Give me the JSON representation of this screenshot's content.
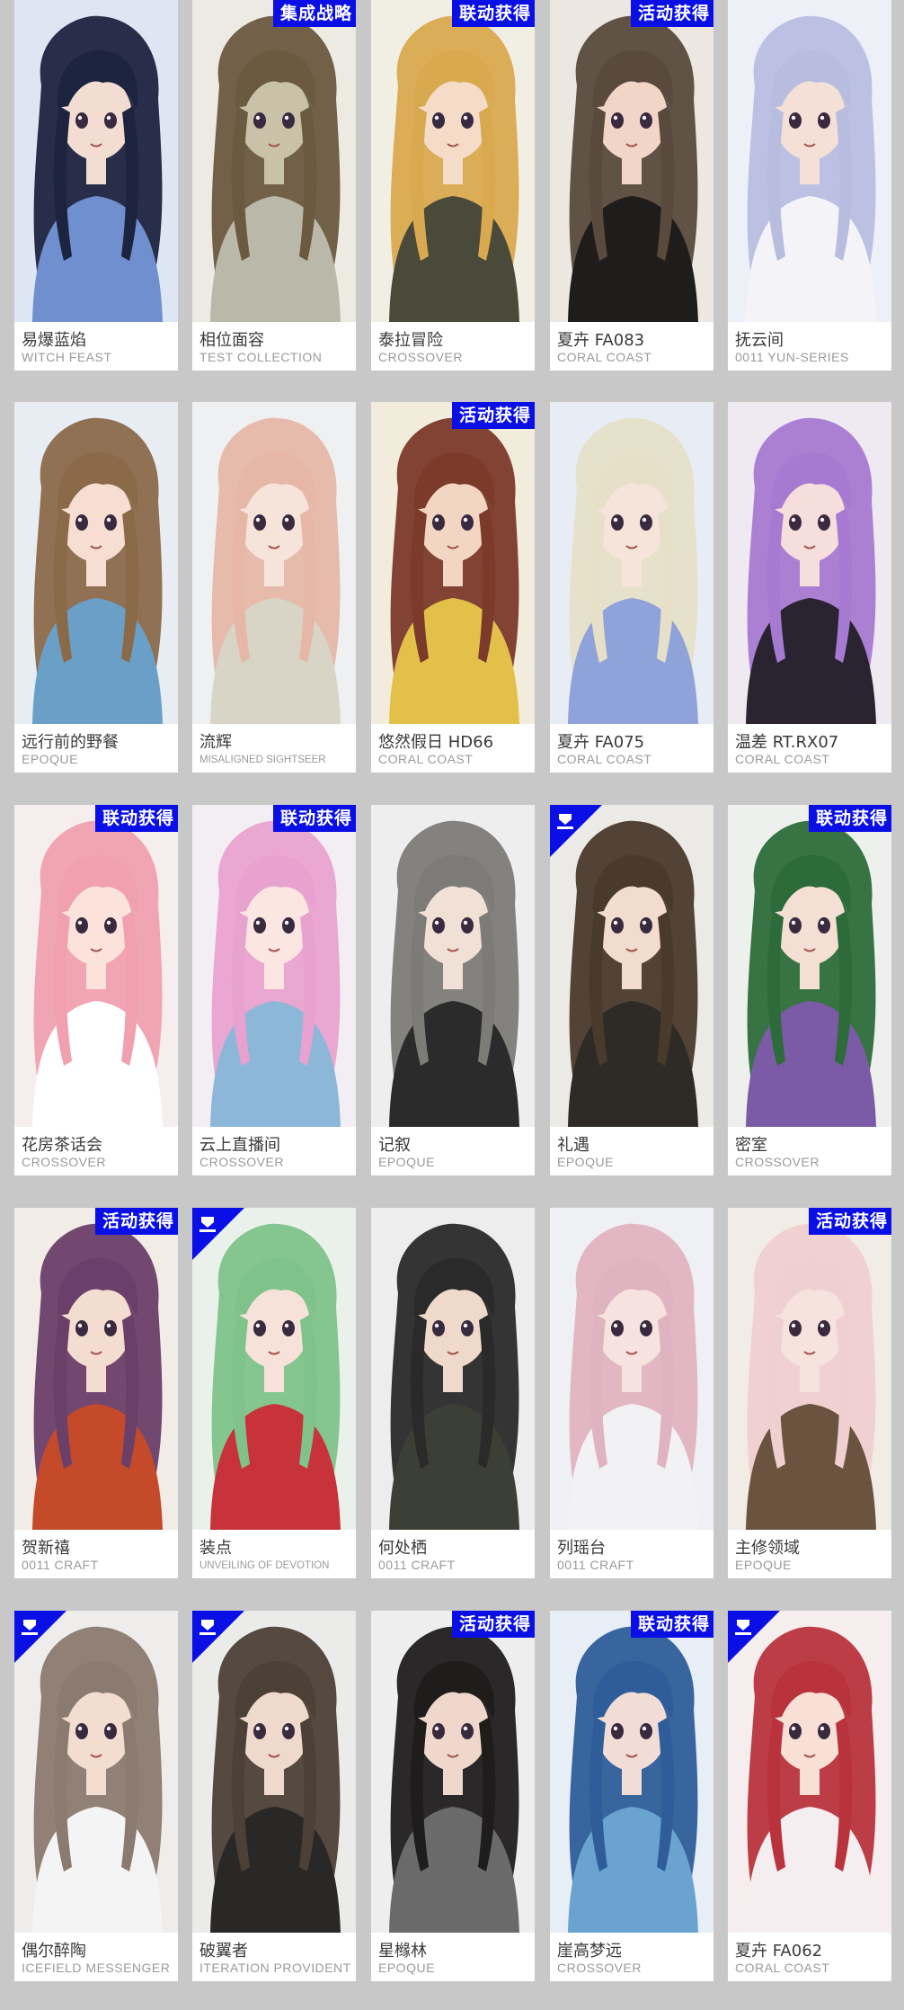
{
  "badge_color": "#0a0fe6",
  "rows": [
    [
      {
        "name": "易爆蓝焰",
        "series": "WITCH FEAST",
        "badge": "",
        "corner": false,
        "hair": "#1d2440",
        "bg": "#dfe6f3",
        "outfit": "#6f8fcf",
        "skin": "#f3ddd3"
      },
      {
        "name": "相位面容",
        "series": "TEST COLLECTION",
        "badge": "集成战略",
        "corner": false,
        "hair": "#6b5a3f",
        "bg": "#eceae3",
        "outfit": "#b9b8a9",
        "skin": "#c9c2a8"
      },
      {
        "name": "泰拉冒险",
        "series": "CROSSOVER",
        "badge": "联动获得",
        "corner": false,
        "hair": "#d9a94f",
        "bg": "#f1eee4",
        "outfit": "#4a4a3a",
        "skin": "#f4dcc8"
      },
      {
        "name": "夏卉 FA083",
        "series": "CORAL COAST",
        "badge": "活动获得",
        "corner": false,
        "hair": "#5a4a3d",
        "bg": "#ece8e1",
        "outfit": "#1f1c1c",
        "skin": "#f1d5c7"
      },
      {
        "name": "抚云间",
        "series": "0011 YUN-SERIES",
        "badge": "",
        "corner": false,
        "hair": "#b8bde0",
        "bg": "#eef0f7",
        "outfit": "#f4f4f8",
        "skin": "#f5e0d7"
      }
    ],
    [
      {
        "name": "远行前的野餐",
        "series": "EPOQUE",
        "badge": "",
        "corner": false,
        "hair": "#8b6a4a",
        "bg": "#e7edf2",
        "outfit": "#6aa0c8",
        "skin": "#f6dfd2"
      },
      {
        "name": "流辉",
        "series": "MISALIGNED SIGHTSEER",
        "badge": "",
        "corner": false,
        "hair": "#e6b7a6",
        "bg": "#eef0f1",
        "outfit": "#d9d5c6",
        "skin": "#f6e3da",
        "small": true
      },
      {
        "name": "悠然假日 HD66",
        "series": "CORAL COAST",
        "badge": "活动获得",
        "corner": false,
        "hair": "#7c3a2a",
        "bg": "#f2ecdc",
        "outfit": "#e3c04a",
        "skin": "#f3d5c3"
      },
      {
        "name": "夏卉 FA075",
        "series": "CORAL COAST",
        "badge": "",
        "corner": false,
        "hair": "#e6e0c8",
        "bg": "#e8ecf5",
        "outfit": "#8fa2d9",
        "skin": "#f6e4da"
      },
      {
        "name": "温差 RT.RX07",
        "series": "CORAL COAST",
        "badge": "",
        "corner": false,
        "hair": "#a77ad1",
        "bg": "#efe9f2",
        "outfit": "#2a2430",
        "skin": "#f6dedc"
      }
    ],
    [
      {
        "name": "花房茶话会",
        "series": "CROSSOVER",
        "badge": "联动获得",
        "corner": false,
        "hair": "#f0a0ae",
        "bg": "#f6eeee",
        "outfit": "#ffffff",
        "skin": "#fbe3dc"
      },
      {
        "name": "云上直播间",
        "series": "CROSSOVER",
        "badge": "联动获得",
        "corner": false,
        "hair": "#e8a2cf",
        "bg": "#f3eef3",
        "outfit": "#8cb7d9",
        "skin": "#fbe6e2"
      },
      {
        "name": "记叙",
        "series": "EPOQUE",
        "badge": "",
        "corner": false,
        "hair": "#7d7b78",
        "bg": "#eeeeee",
        "outfit": "#2b2b2b",
        "skin": "#f1e0d6"
      },
      {
        "name": "礼遇",
        "series": "EPOQUE",
        "badge": "",
        "corner": true,
        "hair": "#4a3a2c",
        "bg": "#eceae6",
        "outfit": "#2e2b27",
        "skin": "#f2dccd"
      },
      {
        "name": "密室",
        "series": "CROSSOVER",
        "badge": "联动获得",
        "corner": false,
        "hair": "#2d6b3a",
        "bg": "#eef0ee",
        "outfit": "#7b5aa6",
        "skin": "#f3dfd4"
      }
    ],
    [
      {
        "name": "贺新禧",
        "series": "0011 CRAFT",
        "badge": "活动获得",
        "corner": false,
        "hair": "#6a3f6a",
        "bg": "#f2ece6",
        "outfit": "#c44a2a",
        "skin": "#f3dcd0"
      },
      {
        "name": "装点",
        "series": "UNVEILING OF DEVOTION",
        "badge": "",
        "corner": true,
        "hair": "#7fc28a",
        "bg": "#eaf1ea",
        "outfit": "#c8323a",
        "skin": "#f6e2d8",
        "small": true
      },
      {
        "name": "何处栖",
        "series": "0011 CRAFT",
        "badge": "",
        "corner": false,
        "hair": "#2a2a2a",
        "bg": "#ededed",
        "outfit": "#3c3f35",
        "skin": "#efd9cb"
      },
      {
        "name": "列瑶台",
        "series": "0011 CRAFT",
        "badge": "",
        "corner": false,
        "hair": "#e0b3c0",
        "bg": "#eef0f3",
        "outfit": "#f2f2f5",
        "skin": "#f6e2de"
      },
      {
        "name": "主修领域",
        "series": "EPOQUE",
        "badge": "活动获得",
        "corner": false,
        "hair": "#efcfd0",
        "bg": "#f1ece6",
        "outfit": "#6b543f",
        "skin": "#f6e3dd"
      }
    ],
    [
      {
        "name": "偶尔醉陶",
        "series": "ICEFIELD MESSENGER",
        "badge": "",
        "corner": true,
        "hair": "#8a7a6f",
        "bg": "#efedeb",
        "outfit": "#f4f4f4",
        "skin": "#f3ddd0"
      },
      {
        "name": "破翼者",
        "series": "ITERATION PROVIDENT",
        "badge": "",
        "corner": true,
        "hair": "#4d4037",
        "bg": "#ebebea",
        "outfit": "#2a2826",
        "skin": "#efd9cd"
      },
      {
        "name": "星橼林",
        "series": "EPOQUE",
        "badge": "活动获得",
        "corner": false,
        "hair": "#1f1c1c",
        "bg": "#eeeeee",
        "outfit": "#6a6a6a",
        "skin": "#efd8cb"
      },
      {
        "name": "崖高梦远",
        "series": "CROSSOVER",
        "badge": "联动获得",
        "corner": false,
        "hair": "#2f5d9a",
        "bg": "#e8eef6",
        "outfit": "#6aa3d0",
        "skin": "#f1dcd6"
      },
      {
        "name": "夏卉 FA062",
        "series": "CORAL COAST",
        "badge": "",
        "corner": true,
        "hair": "#b8333c",
        "bg": "#f6eeee",
        "outfit": "#f4eef0",
        "skin": "#f8e0d6"
      }
    ]
  ]
}
